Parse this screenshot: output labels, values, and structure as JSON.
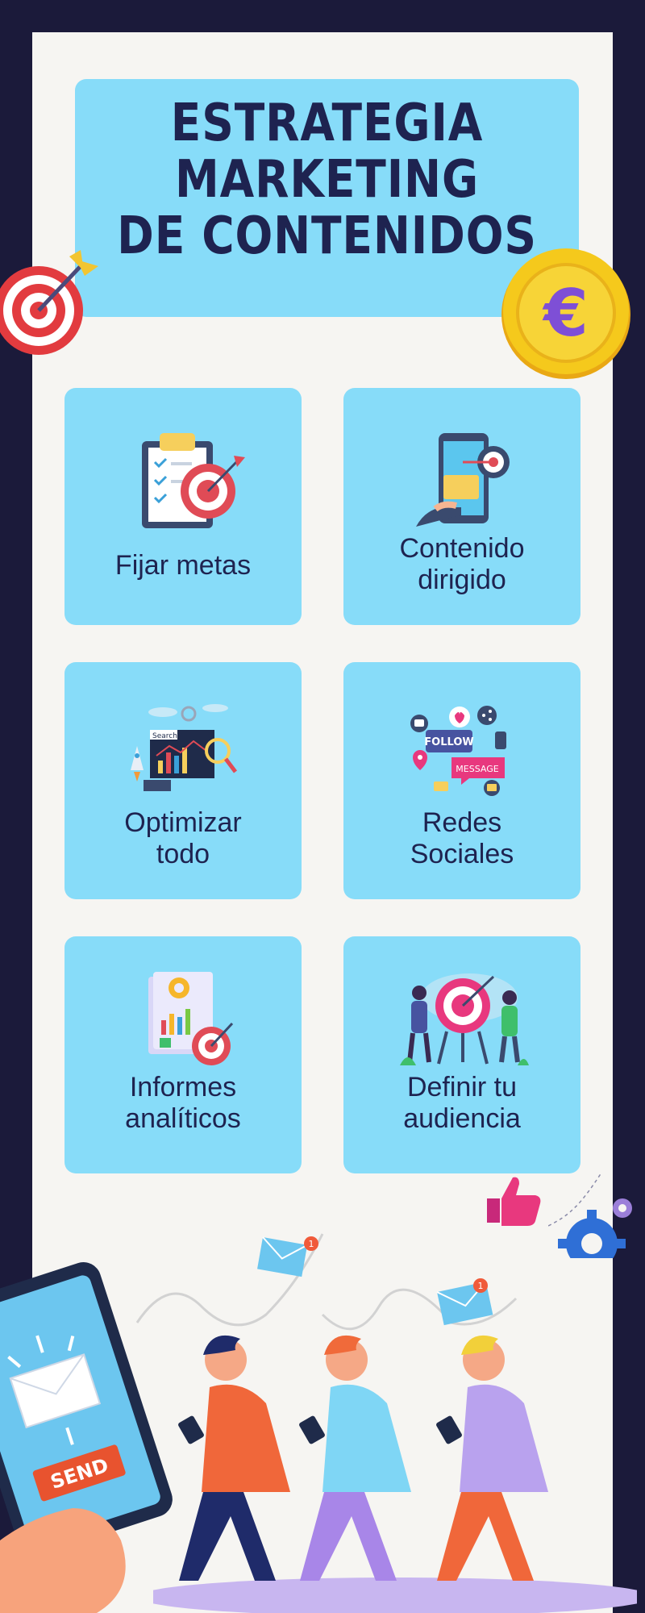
{
  "title": {
    "line1": "ESTRATEGIA",
    "line2": "MARKETING",
    "line3": "DE CONTENIDOS"
  },
  "cards": [
    {
      "id": "fijar-metas",
      "line1": "Fijar metas",
      "line2": "",
      "icon": "clipboard-target-icon"
    },
    {
      "id": "contenido-dirigido",
      "line1": "Contenido",
      "line2": "dirigido",
      "icon": "phone-target-icon"
    },
    {
      "id": "optimizar-todo",
      "line1": "Optimizar",
      "line2": "todo",
      "icon": "seo-search-chart-icon"
    },
    {
      "id": "redes-sociales",
      "line1": "Redes",
      "line2": "Sociales",
      "icon": "social-media-icon"
    },
    {
      "id": "informes-analiticos",
      "line1": "Informes",
      "line2": "analíticos",
      "icon": "report-chart-icon"
    },
    {
      "id": "definir-audiencia",
      "line1": "Definir tu",
      "line2": "audiencia",
      "icon": "audience-target-icon"
    }
  ],
  "icon_text": {
    "search": "Search",
    "follow": "FOLLOW",
    "message": "MESSAGE",
    "send": "SEND",
    "euro": "€",
    "notification": "1"
  },
  "colors": {
    "frame": "#1b1a3a",
    "panel": "#f6f5f2",
    "card": "#87dcf9",
    "text": "#1e2350"
  }
}
